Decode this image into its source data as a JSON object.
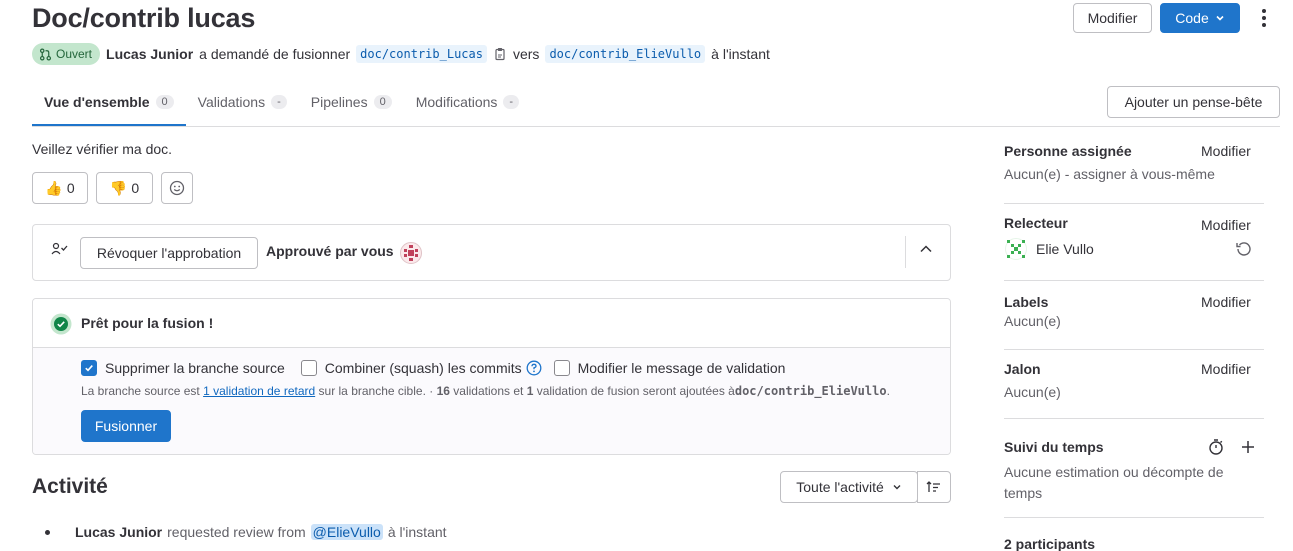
{
  "header": {
    "title": "Doc/contrib lucas",
    "modify_label": "Modifier",
    "code_label": "Code",
    "status": "Ouvert",
    "author": "Lucas Junior",
    "action_text": "a demandé de fusionner",
    "source_branch": "doc/contrib_Lucas",
    "to_text": "vers",
    "target_branch": "doc/contrib_ElieVullo",
    "time": "à l'instant"
  },
  "tabs": [
    {
      "label": "Vue d'ensemble",
      "count": "0"
    },
    {
      "label": "Validations",
      "count": "-"
    },
    {
      "label": "Pipelines",
      "count": "0"
    },
    {
      "label": "Modifications",
      "count": "-"
    }
  ],
  "todo_label": "Ajouter un pense-bête",
  "description": "Veillez vérifier ma doc.",
  "reactions": {
    "thumbs_up": "0",
    "thumbs_down": "0"
  },
  "approval": {
    "revoke_label": "Révoquer l'approbation",
    "approved_text": "Approuvé par vous"
  },
  "merge": {
    "ready_text": "Prêt pour la fusion !",
    "opt_delete_branch": "Supprimer la branche source",
    "opt_squash": "Combiner (squash) les commits",
    "opt_edit_message": "Modifier le message de validation",
    "info_prefix": "La branche source est",
    "info_link": "1 validation de retard",
    "info_mid": "sur la branche cible. ·",
    "info_count1": "16",
    "info_mid2": "validations et",
    "info_count2": "1",
    "info_mid3": "validation de fusion seront ajoutées à",
    "info_branch": "doc/contrib_ElieVullo",
    "info_end": ".",
    "merge_label": "Fusionner"
  },
  "activity": {
    "title": "Activité",
    "filter_label": "Toute l'activité",
    "entry_author": "Lucas Junior",
    "entry_text": "requested review from",
    "entry_mention": "@ElieVullo",
    "entry_time": "à l'instant"
  },
  "sidebar": {
    "edit_label": "Modifier",
    "assignee_label": "Personne assignée",
    "assignee_value": "Aucun(e) - assigner à vous-même",
    "reviewer_label": "Relecteur",
    "reviewer_name": "Elie Vullo",
    "labels_label": "Labels",
    "labels_value": "Aucun(e)",
    "milestone_label": "Jalon",
    "milestone_value": "Aucun(e)",
    "time_label": "Suivi du temps",
    "time_value": "Aucune estimation ou décompte de temps",
    "participants": "2 participants"
  },
  "colors": {
    "primary": "#1f75cb",
    "success": "#108548",
    "open_badge_bg": "#c3e6cd"
  }
}
